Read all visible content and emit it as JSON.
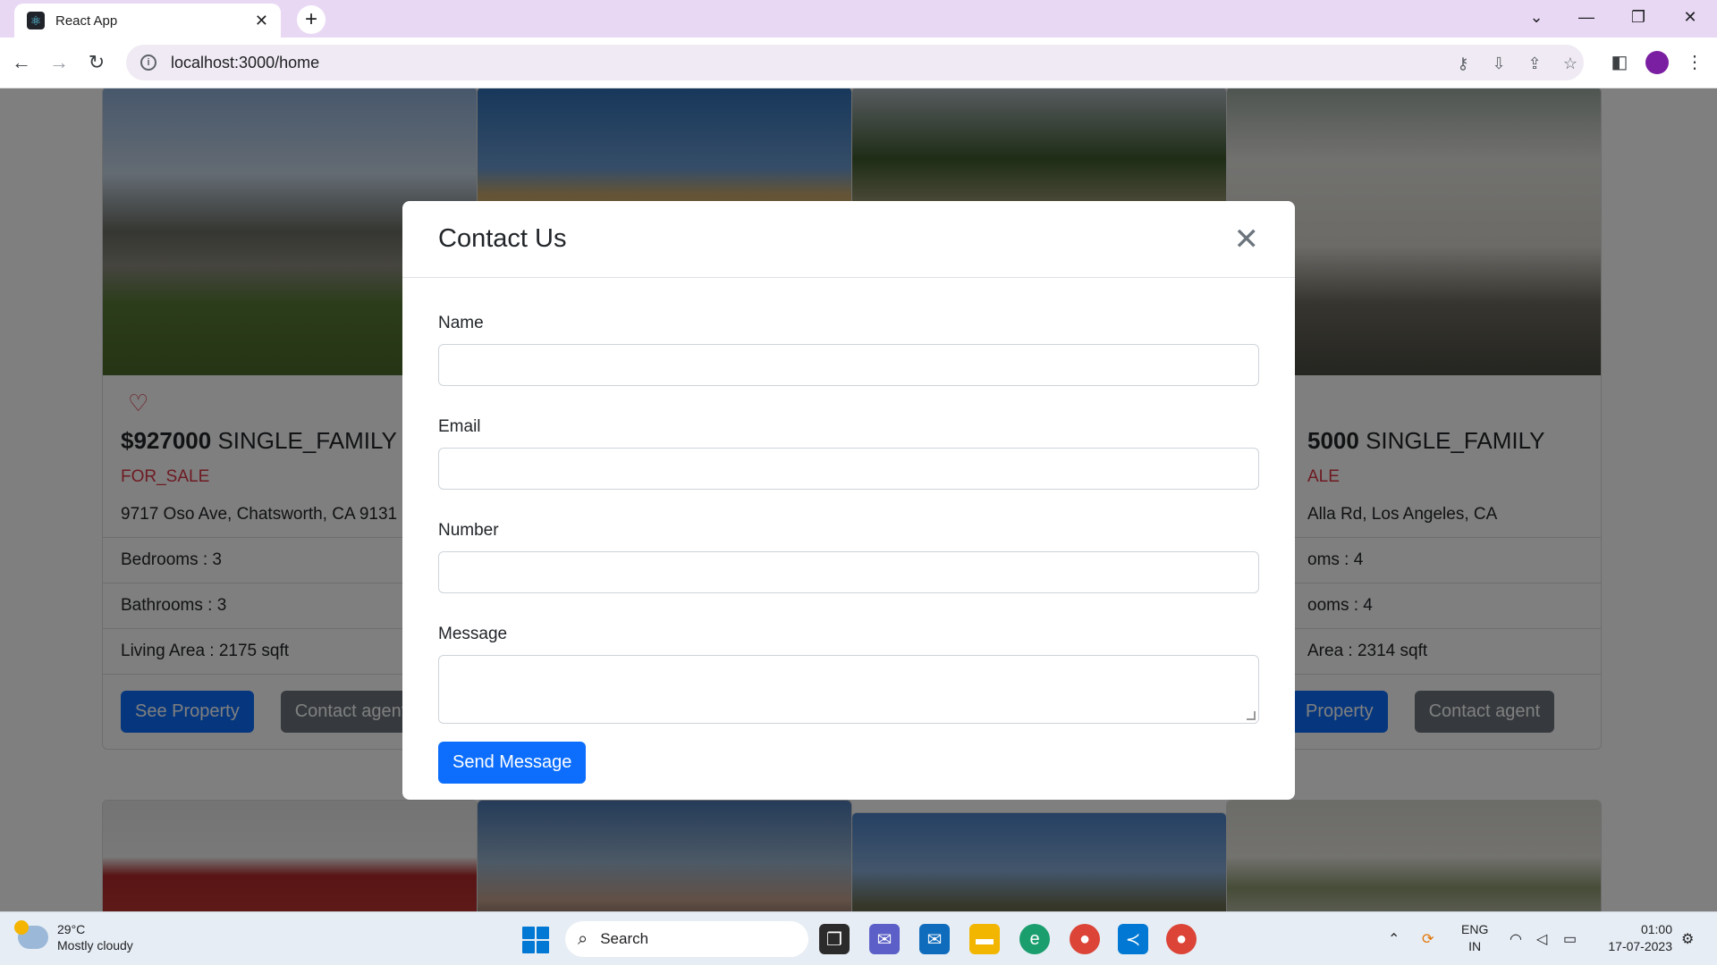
{
  "browser": {
    "tab_title": "React App",
    "url": "localhost:3000/home"
  },
  "cards": [
    {
      "price": "$927000",
      "type": "SINGLE_FAMILY",
      "status": "FOR_SALE",
      "address": "9717 Oso Ave, Chatsworth, CA 9131",
      "bedrooms": "Bedrooms : 3",
      "bathrooms": "Bathrooms : 3",
      "living_area": "Living Area : 2175 sqft",
      "see_property": "See Property",
      "contact_agent": "Contact agent"
    },
    {
      "price": "5000",
      "type": "SINGLE_FAMILY",
      "status": "ALE",
      "address": "Alla Rd, Los Angeles, CA",
      "bedrooms": "oms : 4",
      "bathrooms": "ooms : 4",
      "living_area": "Area : 2314 sqft",
      "see_property": "Property",
      "contact_agent": "Contact agent"
    }
  ],
  "modal": {
    "title": "Contact Us",
    "name_label": "Name",
    "email_label": "Email",
    "number_label": "Number",
    "message_label": "Message",
    "send_label": "Send Message"
  },
  "taskbar": {
    "temperature": "29°C",
    "weather": "Mostly cloudy",
    "search": "Search",
    "lang_1": "ENG",
    "lang_2": "IN",
    "time": "01:00",
    "date": "17-07-2023"
  }
}
